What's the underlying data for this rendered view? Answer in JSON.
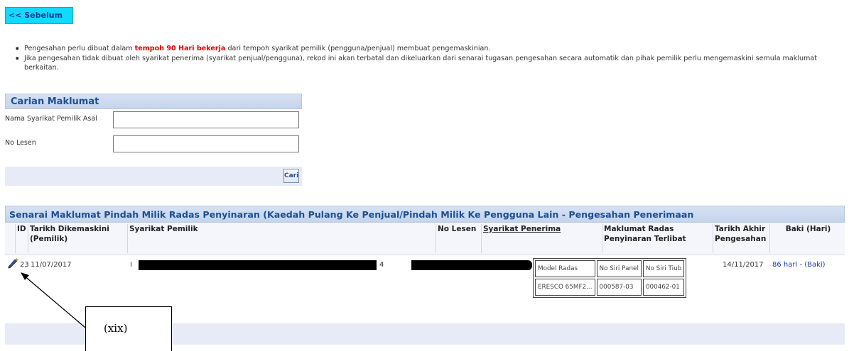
{
  "back_button": {
    "label": "<< Sebelum"
  },
  "notes": [
    {
      "before": "Pengesahan perlu dibuat dalam ",
      "highlight": "tempoh 90 Hari bekerja",
      "after": " dari tempoh syarikat pemilik (pengguna/penjual) membuat pengemaskinian."
    },
    {
      "text": "Jika pengesahan tidak dibuat oleh syarikat penerima (syarikat penjual/pengguna), rekod ini akan terbatal dan dikeluarkan dari senarai tugasan pengesahan secara automatik dan pihak pemilik perlu mengemaskini semula maklumat berkaitan."
    }
  ],
  "search": {
    "title": "Carian Maklumat",
    "fields": [
      {
        "label": "Nama Syarikat Pemilik Asal",
        "value": ""
      },
      {
        "label": "No Lesen",
        "value": ""
      }
    ],
    "button_label": "Cari"
  },
  "list": {
    "title": "Senarai Maklumat Pindah Milik Radas Penyinaran (Kaedah Pulang Ke Penjual/Pindah Milik Ke Pengguna Lain - Pengesahan Penerimaan",
    "headers": {
      "id": "ID",
      "tarikh": "Tarikh Dikemaskini (Pemilik)",
      "syarikat_pemilik": "Syarikat Pemilik",
      "no_lesen": "No Lesen",
      "syarikat_penerima": "Syarikat Penerima",
      "maklumat_radas": "Maklumat Radas Penyinaran Terlibat",
      "tarikh_akhir": "Tarikh Akhir Pengesahan",
      "baki": "Baki (Hari)"
    },
    "rows": [
      {
        "id": "23",
        "tarikh": "11/07/2017",
        "syarikat_pemilik_prefix": "I",
        "no_lesen_suffix": "4",
        "radas_headers": [
          "Model Radas",
          "No Siri Panel",
          "No Siri Tiub"
        ],
        "radas_values": [
          "ERESCO 65MF2...",
          "000587-03",
          "000462-01"
        ],
        "tarikh_akhir": "14/11/2017",
        "baki": "86 hari - (Baki)"
      }
    ]
  },
  "callout": {
    "label": "(xix)"
  },
  "icons": {
    "edit": "pencil-edit-icon"
  }
}
